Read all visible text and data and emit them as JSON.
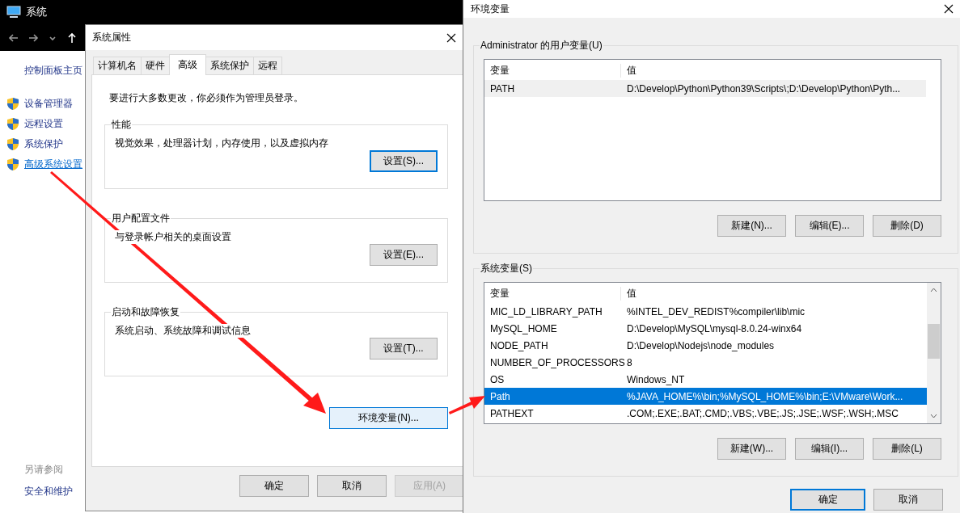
{
  "system_window": {
    "title": "系统",
    "sidebar": {
      "home_link": "控制面板主页",
      "items": [
        {
          "label": "设备管理器",
          "selected": false
        },
        {
          "label": "远程设置",
          "selected": false
        },
        {
          "label": "系统保护",
          "selected": false
        },
        {
          "label": "高级系统设置",
          "selected": true
        }
      ],
      "see_also": "另请参阅",
      "see_also_links": [
        "安全和维护"
      ]
    }
  },
  "system_properties": {
    "title": "系统属性",
    "tabs": [
      {
        "label": "计算机名",
        "selected": false
      },
      {
        "label": "硬件",
        "selected": false
      },
      {
        "label": "高级",
        "selected": true
      },
      {
        "label": "系统保护",
        "selected": false
      },
      {
        "label": "远程",
        "selected": false
      }
    ],
    "admin_note": "要进行大多数更改，你必须作为管理员登录。",
    "groups": [
      {
        "title": "性能",
        "description": "视觉效果，处理器计划，内存使用，以及虚拟内存",
        "button": "设置(S)...",
        "focused": true
      },
      {
        "title": "用户配置文件",
        "description": "与登录帐户相关的桌面设置",
        "button": "设置(E)...",
        "focused": false
      },
      {
        "title": "启动和故障恢复",
        "description": "系统启动、系统故障和调试信息",
        "button": "设置(T)...",
        "focused": false
      }
    ],
    "env_button": {
      "label": "环境变量(N)...",
      "hovered": true
    },
    "buttons": [
      {
        "label": "确定",
        "disabled": false
      },
      {
        "label": "取消",
        "disabled": false
      },
      {
        "label": "应用(A)",
        "disabled": true
      }
    ]
  },
  "environment_variables": {
    "title": "环境变量",
    "lists": [
      {
        "title": "Administrator 的用户变量(U)",
        "focused": false,
        "scrollable": false,
        "columns": [
          "变量",
          "值"
        ],
        "rows": [
          {
            "name": "PATH",
            "value": "D:\\Develop\\Python\\Python39\\Scripts\\;D:\\Develop\\Python\\Pyth...",
            "selected": true
          }
        ],
        "buttons": [
          "新建(N)...",
          "编辑(E)...",
          "删除(D)"
        ]
      },
      {
        "title": "系统变量(S)",
        "focused": true,
        "scrollable": true,
        "columns": [
          "变量",
          "值"
        ],
        "rows": [
          {
            "name": "MIC_LD_LIBRARY_PATH",
            "value": "%INTEL_DEV_REDIST%compiler\\lib\\mic",
            "selected": false
          },
          {
            "name": "MySQL_HOME",
            "value": "D:\\Develop\\MySQL\\mysql-8.0.24-winx64",
            "selected": false
          },
          {
            "name": "NODE_PATH",
            "value": "D:\\Develop\\Nodejs\\node_modules",
            "selected": false
          },
          {
            "name": "NUMBER_OF_PROCESSORS",
            "value": "8",
            "selected": false
          },
          {
            "name": "OS",
            "value": "Windows_NT",
            "selected": false
          },
          {
            "name": "Path",
            "value": "%JAVA_HOME%\\bin;%MySQL_HOME%\\bin;E:\\VMware\\Work...",
            "selected": true
          },
          {
            "name": "PATHEXT",
            "value": ".COM;.EXE;.BAT;.CMD;.VBS;.VBE;.JS;.JSE;.WSF;.WSH;.MSC",
            "selected": false
          }
        ],
        "buttons": [
          "新建(W)...",
          "编辑(I)...",
          "删除(L)"
        ]
      }
    ],
    "buttons": [
      {
        "label": "确定",
        "focused": true
      },
      {
        "label": "取消",
        "focused": false
      }
    ]
  }
}
